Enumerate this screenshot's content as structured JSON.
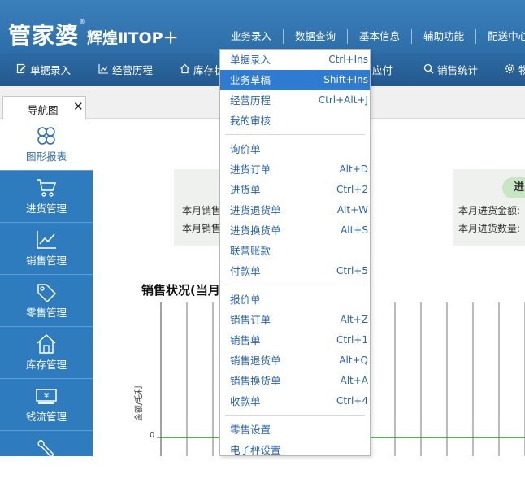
{
  "app": {
    "brand": "管家婆",
    "edition": "辉煌ⅡTOP＋",
    "reg_mark": "®"
  },
  "top_menu": [
    "业务录入",
    "数据查询",
    "基本信息",
    "辅助功能",
    "配送中心"
  ],
  "toolbar": [
    {
      "label": "单据录入",
      "icon": "document-edit-icon"
    },
    {
      "label": "经营历程",
      "icon": "line-chart-icon"
    },
    {
      "label": "库存状",
      "icon": "home-icon"
    },
    {
      "label": "应付",
      "icon": "none"
    },
    {
      "label": "销售统计",
      "icon": "search-icon"
    },
    {
      "label": "物",
      "icon": "gear-icon"
    }
  ],
  "tabs": [
    {
      "label": "导航图",
      "close": "✕"
    }
  ],
  "sidebar": [
    {
      "label": "图形报表",
      "icon": "grid-circles-icon"
    },
    {
      "label": "进货管理",
      "icon": "cart-icon"
    },
    {
      "label": "销售管理",
      "icon": "trend-chart-icon"
    },
    {
      "label": "零售管理",
      "icon": "tag-icon"
    },
    {
      "label": "库存管理",
      "icon": "warehouse-icon"
    },
    {
      "label": "钱流管理",
      "icon": "money-icon"
    },
    {
      "label": "",
      "icon": "wrench-icon"
    }
  ],
  "cards": {
    "left": {
      "row1": "本月销售",
      "row2": "本月销售"
    },
    "right": {
      "pill": "进",
      "row1": "本月进货金额:",
      "row2": "本月进货数量:"
    }
  },
  "chart_data": {
    "type": "line",
    "title": "销售状况(当月",
    "ylabel": "金额/毛利",
    "y_ticks": [
      "0"
    ],
    "series": [
      {
        "values": [
          0,
          0,
          0,
          0,
          0,
          0,
          0,
          0,
          0,
          0,
          0,
          0,
          0,
          0
        ],
        "color": "#2e8b2e"
      }
    ],
    "grid": true
  },
  "dropdown": {
    "groups": [
      [
        {
          "label": "单据录入",
          "shortcut": "Ctrl+Ins"
        },
        {
          "label": "业务草稿",
          "shortcut": "Shift+Ins",
          "highlighted": true
        },
        {
          "label": "经营历程",
          "shortcut": "Ctrl+Alt+J"
        },
        {
          "label": "我的审核",
          "shortcut": ""
        }
      ],
      [
        {
          "label": "询价单",
          "shortcut": ""
        },
        {
          "label": "进货订单",
          "shortcut": "Alt+D"
        },
        {
          "label": "进货单",
          "shortcut": "Ctrl+2"
        },
        {
          "label": "进货退货单",
          "shortcut": "Alt+W"
        },
        {
          "label": "进货换货单",
          "shortcut": "Alt+S"
        },
        {
          "label": "联营账款",
          "shortcut": ""
        },
        {
          "label": "付款单",
          "shortcut": "Ctrl+5"
        }
      ],
      [
        {
          "label": "报价单",
          "shortcut": ""
        },
        {
          "label": "销售订单",
          "shortcut": "Alt+Z"
        },
        {
          "label": "销售单",
          "shortcut": "Ctrl+1"
        },
        {
          "label": "销售退货单",
          "shortcut": "Alt+Q"
        },
        {
          "label": "销售换货单",
          "shortcut": "Alt+A"
        },
        {
          "label": "收款单",
          "shortcut": "Ctrl+4"
        }
      ],
      [
        {
          "label": "零售设置",
          "shortcut": ""
        },
        {
          "label": "电子秤设置",
          "shortcut": ""
        }
      ]
    ]
  }
}
